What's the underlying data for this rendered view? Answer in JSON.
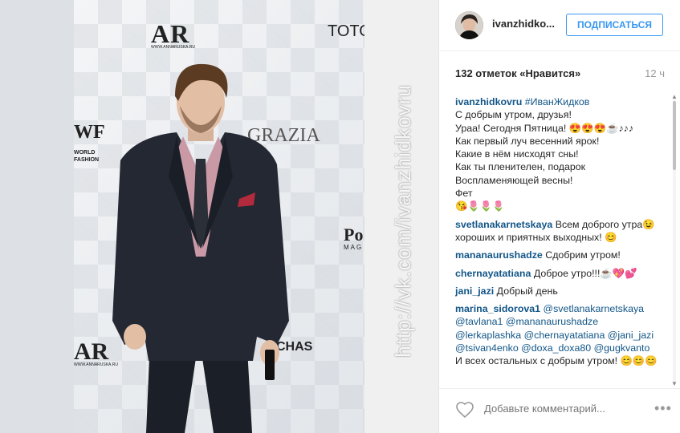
{
  "photo": {
    "logos": {
      "ar_top": "AR",
      "annaruska_url": "WWW.ANNARUSKA.RU",
      "toto": "TOTO",
      "grazia": "GRAZIA",
      "wf": "WF",
      "world_fashion": "WORLD FASHION",
      "po": "Po",
      "mag": "MAG",
      "ar_bottom": "AR",
      "chas": "CHAS"
    },
    "watermark": "http://vk.com/ivanzhidkovru"
  },
  "post": {
    "username": "ivanzhidko...",
    "follow_label": "ПОДПИСАТЬСЯ",
    "likes": "132 отметок «Нравится»",
    "time": "12 ч",
    "caption": {
      "user": "ivanzhidkovru",
      "hashtag": "#ИванЖидков",
      "lines": [
        "С добрым утром, друзья!",
        "Ураа! Сегодня Пятница! 😍😍😍☕♪♪♪",
        "Как первый луч весенний ярок!",
        "Какие в нём нисходят сны!",
        "Как ты пленителен, подарок",
        "Воспламеняющей весны!",
        "Фет",
        "😘🌷🌷🌷"
      ]
    },
    "comments": [
      {
        "user": "svetlanakarnetskaya",
        "text": "Всем доброго утра😉хороших и приятных выходных! 😊"
      },
      {
        "user": "mananaurushadze",
        "text": "Сдобрим утром!"
      },
      {
        "user": "chernayatatiana",
        "text": "Доброе утро!!!☕💖💕"
      },
      {
        "user": "jani_jazi",
        "text": "Добрый день"
      },
      {
        "user": "marina_sidorova1",
        "mentions": "@svetlanakarnetskaya @tavlana1 @mananaurushadze @lerkaplashka @chernayatatiana @jani_jazi @tsivan4enko @doxa_doxa80 @gugkvanto",
        "text": "И всех остальных с добрым утром! 😊😊😊"
      }
    ],
    "comment_placeholder": "Добавьте комментарий...",
    "more_label": "•••"
  },
  "colors": {
    "accent": "#3897f0",
    "username": "#125688",
    "muted": "#999999"
  }
}
